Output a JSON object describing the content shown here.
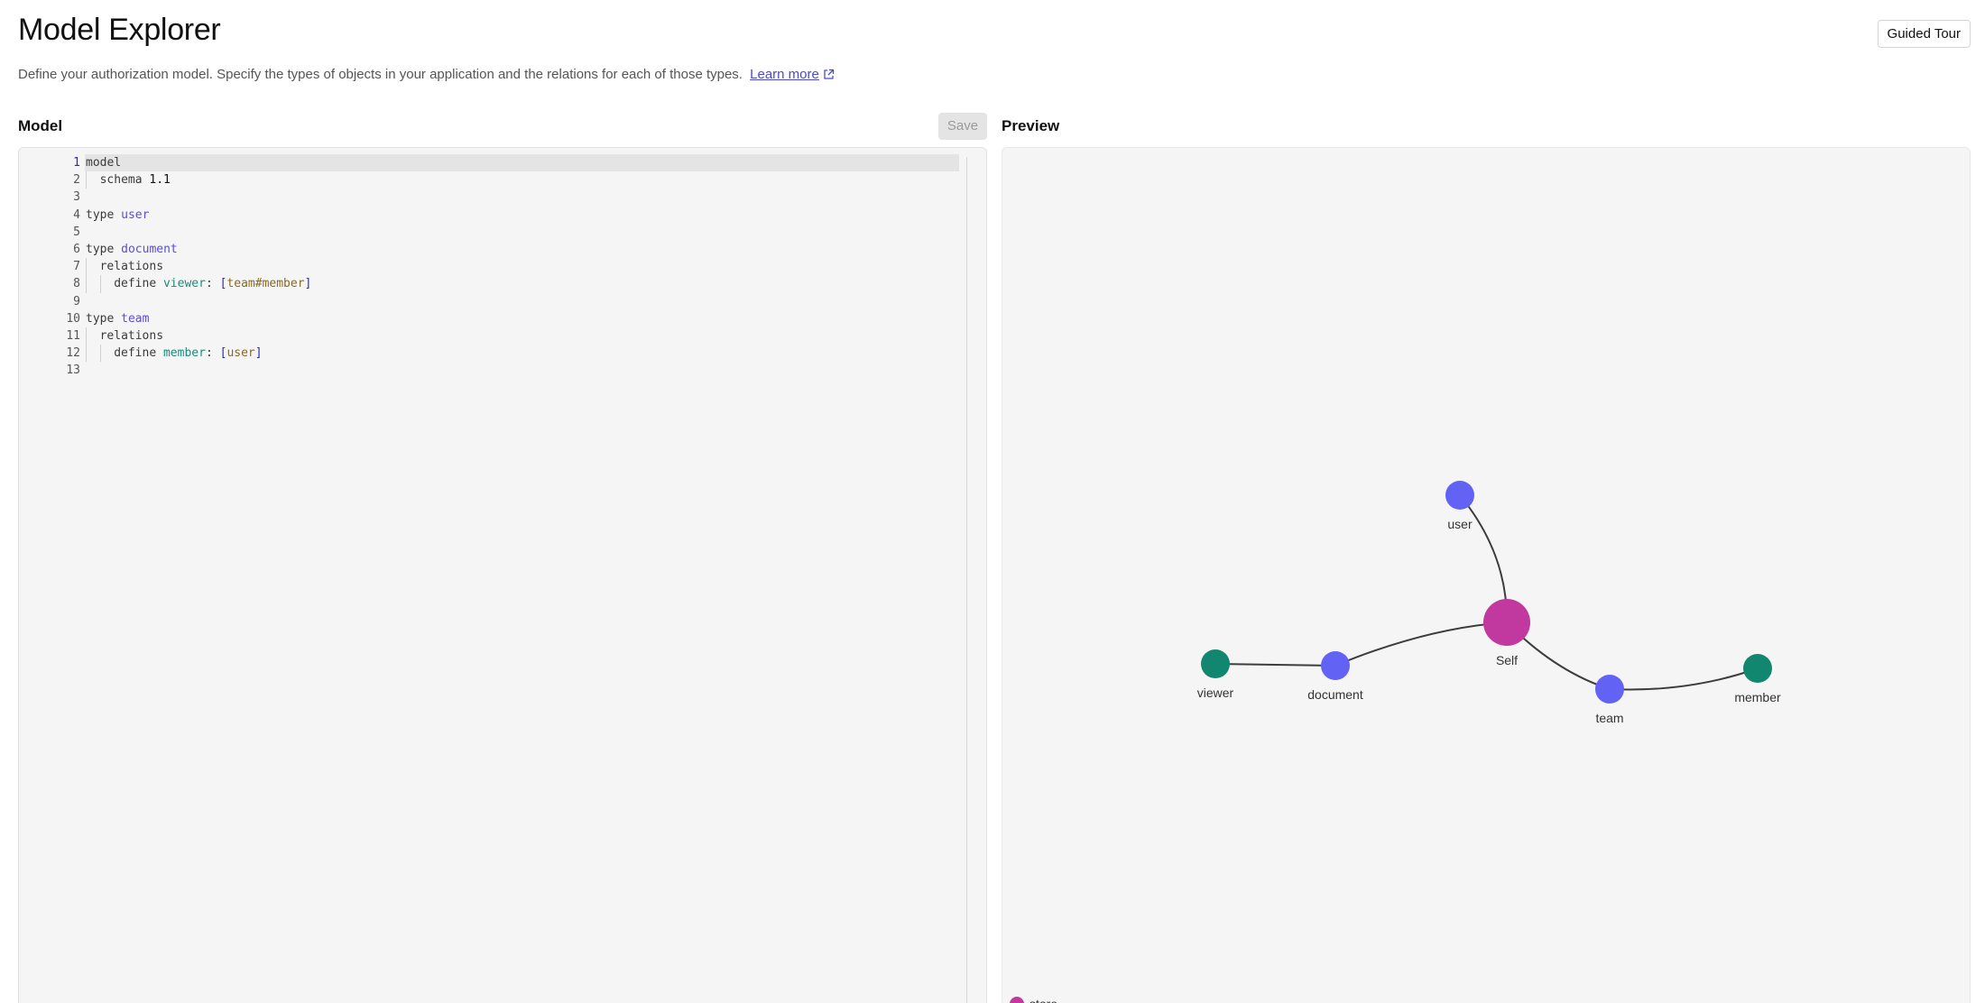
{
  "header": {
    "title": "Model Explorer",
    "guided_tour": "Guided Tour",
    "description": "Define your authorization model. Specify the types of objects in your application and the relations for each of those types.",
    "learn_more": "Learn more"
  },
  "model_panel": {
    "label": "Model",
    "save": "Save",
    "lines": [
      "model",
      "schema 1.1",
      "",
      "type user",
      "",
      "type document",
      "relations",
      "define viewer: [team#member]",
      "",
      "type team",
      "relations",
      "define member: [user]",
      ""
    ]
  },
  "preview_panel": {
    "label": "Preview",
    "nodes": {
      "user": "user",
      "self": "Self",
      "viewer": "viewer",
      "document": "document",
      "team": "team",
      "member": "member"
    },
    "legend": {
      "store": "store"
    },
    "colors": {
      "store": "#c1389e",
      "type": "#6262f5",
      "relation": "#12876f",
      "edge": "#3d3d3d"
    }
  }
}
